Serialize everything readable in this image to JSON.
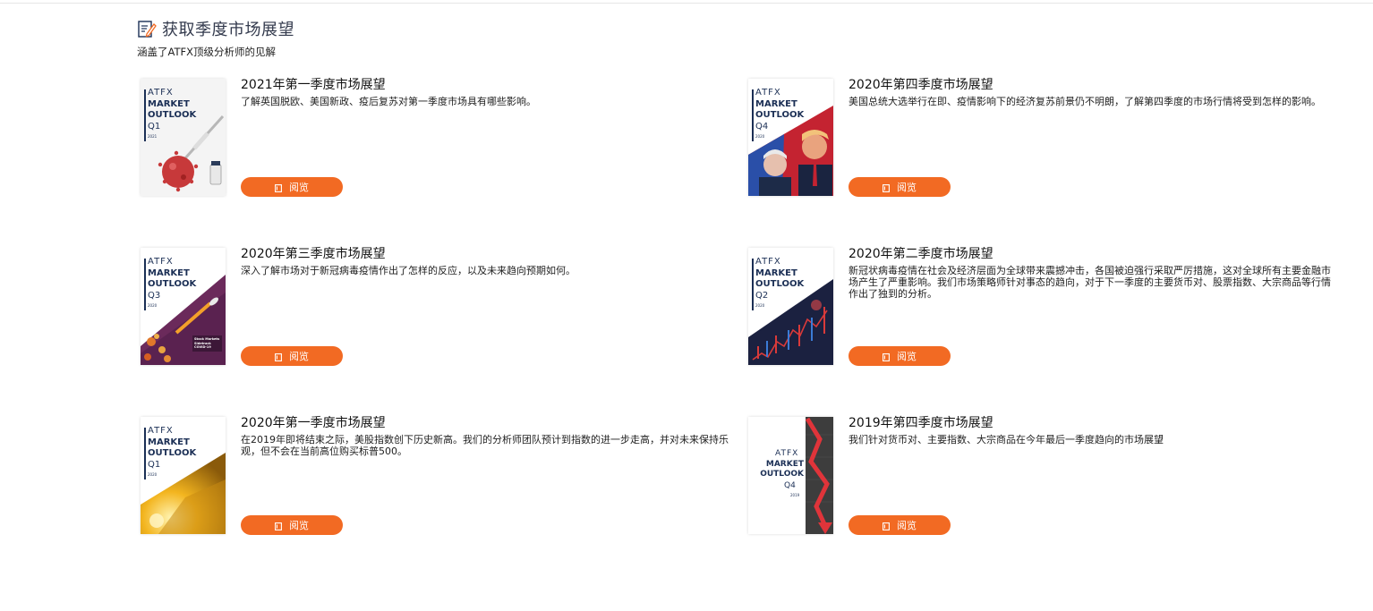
{
  "header": {
    "title": "获取季度市场展望",
    "subtitle": "涵盖了ATFX顶级分析师的见解"
  },
  "colors": {
    "accent": "#f26a23",
    "navy": "#1b2f55",
    "title": "#333a4d"
  },
  "cards": [
    {
      "title": "2021年第一季度市场展望",
      "description": "了解英国脱欧、美国新政、疫后复苏对第一季度市场具有哪些影响。",
      "button_label": "阅览",
      "cover": {
        "brand": "ATFX",
        "headline": "MARKET OUTLOOK",
        "quarter": "Q1",
        "year": "2021",
        "theme": "virus-vaccine"
      }
    },
    {
      "title": "2020年第四季度市场展望",
      "description": "美国总统大选举行在即、疫情影响下的经济复苏前景仍不明朗，了解第四季度的市场行情将受到怎样的影响。",
      "button_label": "阅览",
      "cover": {
        "brand": "ATFX",
        "headline": "MARKET OUTLOOK",
        "quarter": "Q4",
        "year": "2020",
        "theme": "election"
      }
    },
    {
      "title": "2020年第三季度市场展望",
      "description": "深入了解市场对于新冠病毒疫情作出了怎样的反应，以及未来趋向预期如何。",
      "button_label": "阅览",
      "cover": {
        "brand": "ATFX",
        "headline": "MARKET OUTLOOK",
        "quarter": "Q3",
        "year": "2020",
        "theme": "rocket-covid",
        "tagline": "Stock Markets Sidetrack COVID-19"
      }
    },
    {
      "title": "2020年第二季度市场展望",
      "description": "新冠状病毒疫情在社会及经济层面为全球带来震撼冲击，各国被迫强行采取严厉措施，这对全球所有主要金融市场产生了严重影响。我们市场策略师针对事态的趋向，对于下一季度的主要货币对、股票指数、大宗商品等行情作出了独到的分析。",
      "button_label": "阅览",
      "cover": {
        "brand": "ATFX",
        "headline": "MARKET OUTLOOK",
        "quarter": "Q2",
        "year": "2020",
        "theme": "market-chart"
      }
    },
    {
      "title": "2020年第一季度市场展望",
      "description": "在2019年即将结束之际，美股指数创下历史新高。我们的分析师团队预计到指数的进一步走高，并对未来保持乐观，但不会在当前高位购买标普500。",
      "button_label": "阅览",
      "cover": {
        "brand": "ATFX",
        "headline": "MARKET OUTLOOK",
        "quarter": "Q1",
        "year": "2020",
        "theme": "gold"
      }
    },
    {
      "title": "2019年第四季度市场展望",
      "description": "我们针对货币对、主要指数、大宗商品在今年最后一季度趋向的市场展望",
      "button_label": "阅览",
      "cover": {
        "brand": "ATFX",
        "headline": "MARKET OUTLOOK",
        "quarter": "Q4",
        "year": "2019",
        "theme": "red-arrow"
      }
    }
  ]
}
